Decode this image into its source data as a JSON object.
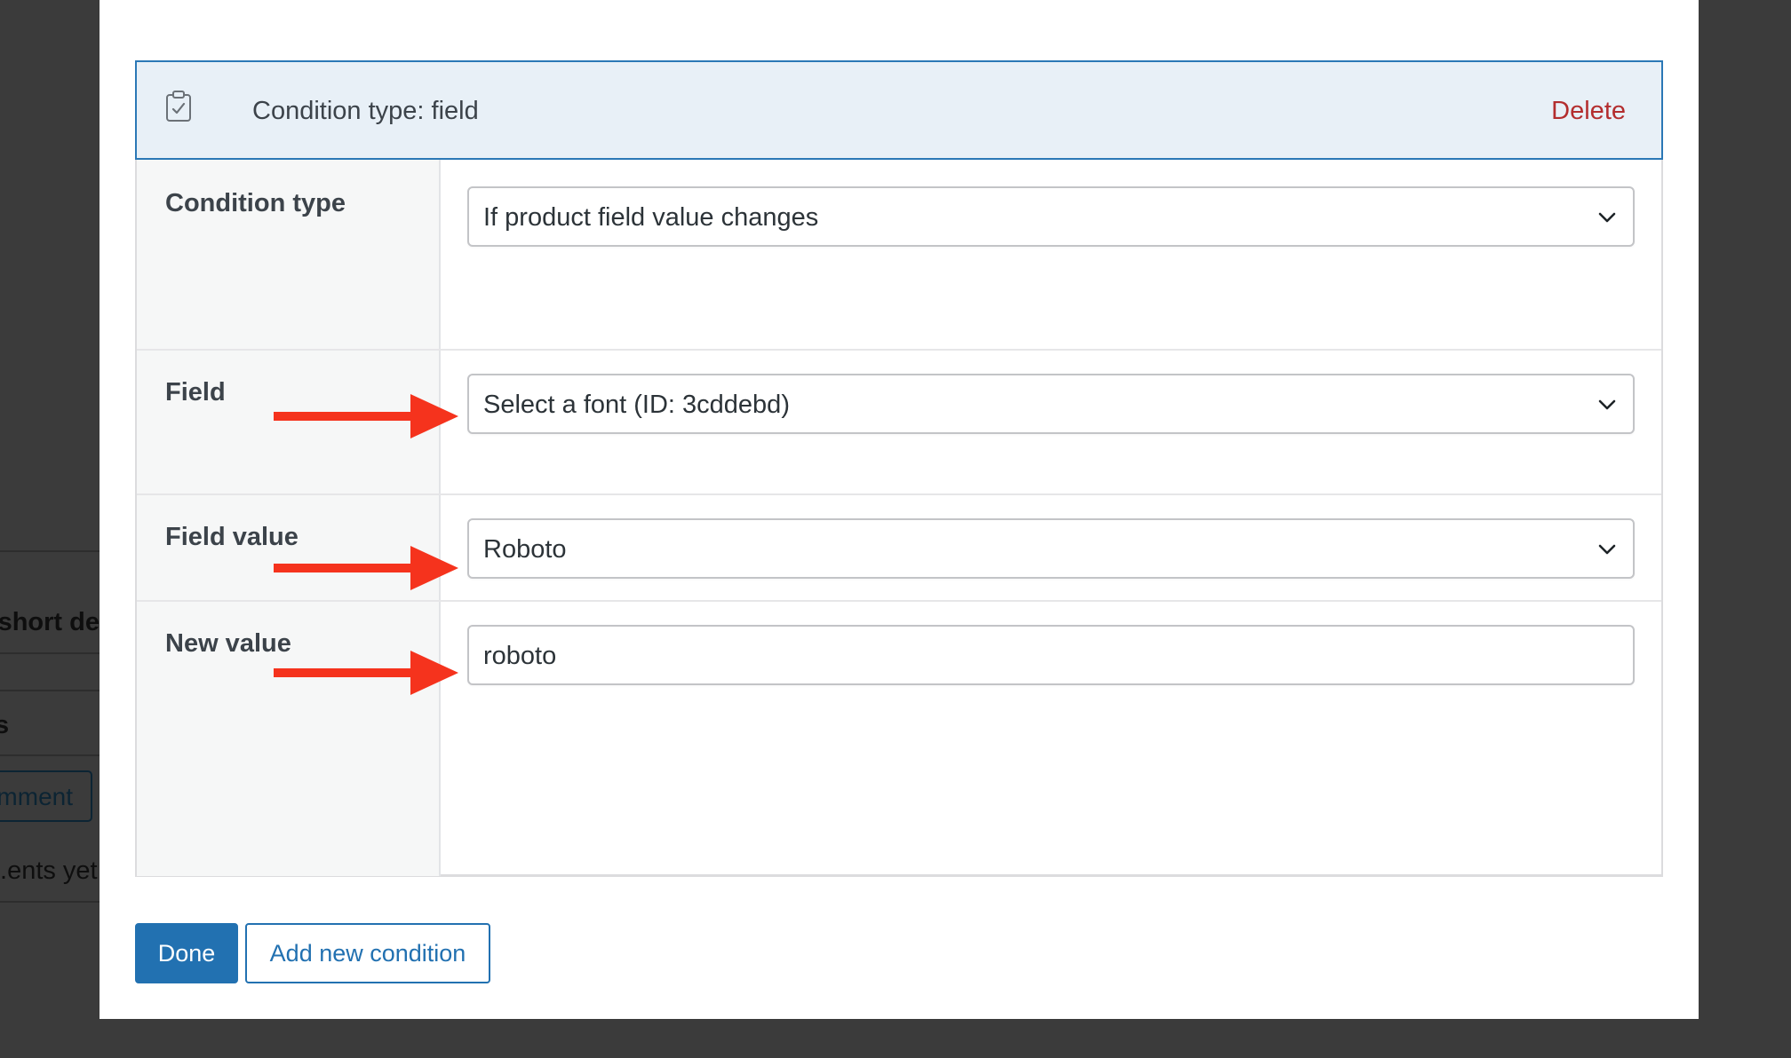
{
  "background": {
    "heading_fragment": "short de",
    "letter_fragment": "s",
    "button_fragment": "mment",
    "text_fragment": "ents yet."
  },
  "header": {
    "icon": "clipboard-check-icon",
    "title": "Condition type: field",
    "delete_label": "Delete"
  },
  "rows": [
    {
      "label": "Condition type",
      "value": "If product field value changes",
      "control": "select"
    },
    {
      "label": "Field",
      "value": "Select a font (ID: 3cddebd)",
      "control": "select",
      "annotated": true
    },
    {
      "label": "Field value",
      "value": "Roboto",
      "control": "select",
      "annotated": true
    },
    {
      "label": "New value",
      "value": "roboto",
      "control": "text",
      "annotated": true
    }
  ],
  "footer": {
    "done_label": "Done",
    "add_label": "Add new condition"
  },
  "colors": {
    "header_bg": "#e8f0f7",
    "header_border": "#2b78b6",
    "delete": "#b32d2e",
    "primary": "#2271b1",
    "annotation_arrow": "#f5331d"
  }
}
